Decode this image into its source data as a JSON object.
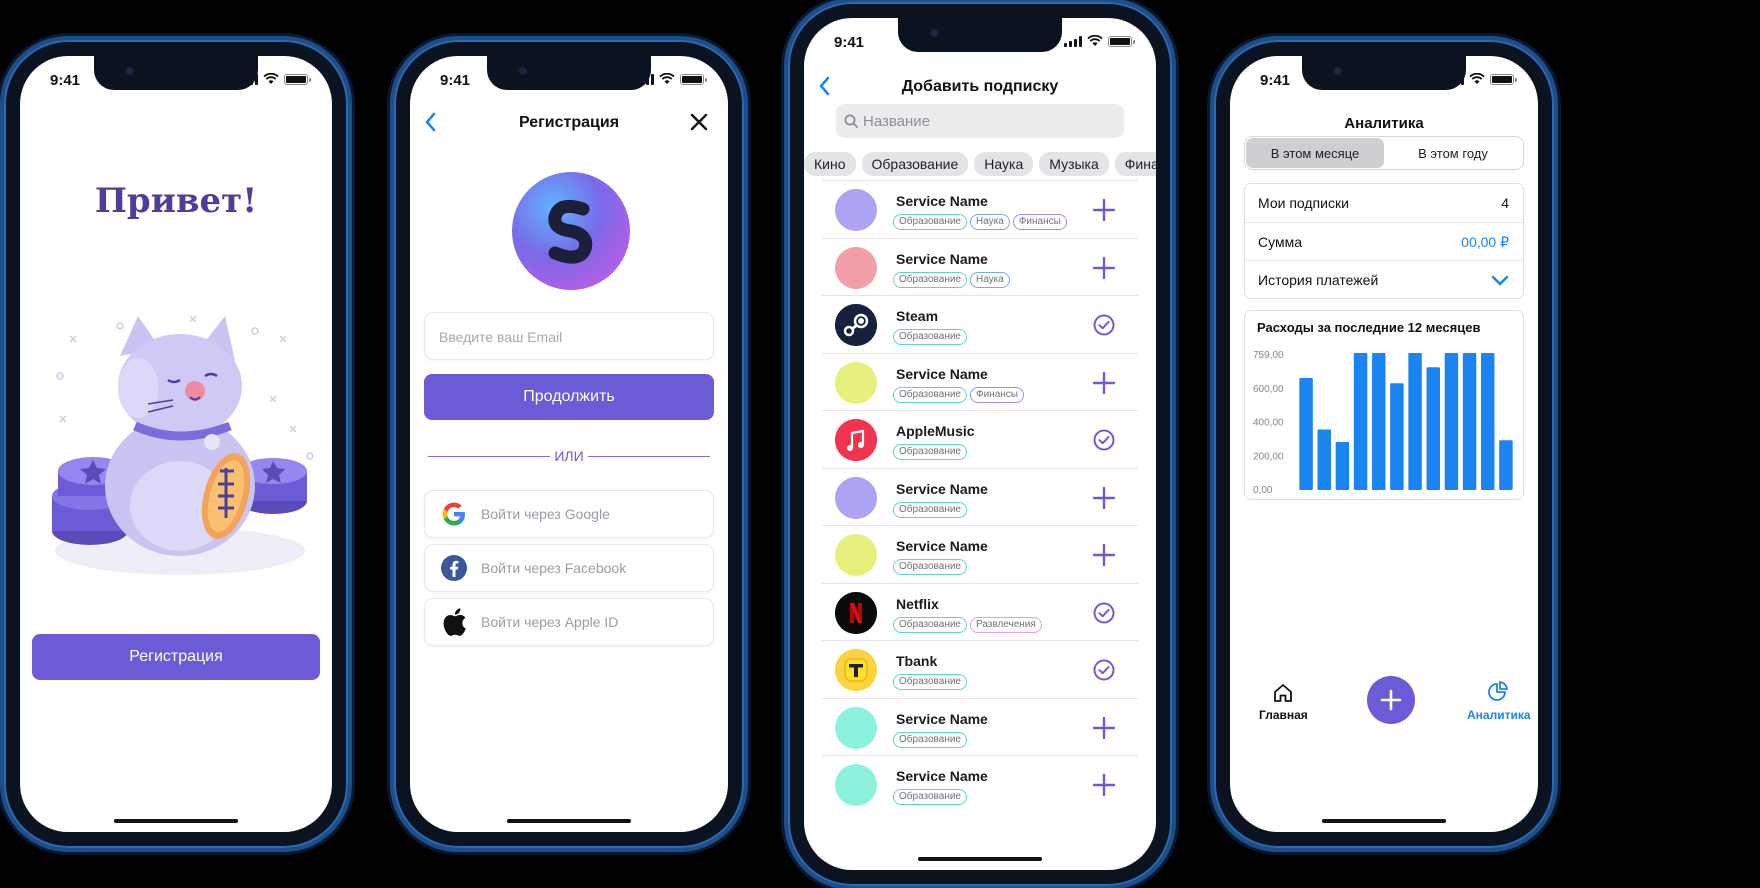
{
  "status_time": "9:41",
  "colors": {
    "accent": "#6b5bd6",
    "title_purple": "#4b3f9c",
    "blue": "#1a84f0",
    "tag_teal": "#5fd6c3"
  },
  "welcome": {
    "greeting": "Привет!",
    "register_button": "Регистрация"
  },
  "registration": {
    "title": "Регистрация",
    "email_placeholder": "Введите ваш Email",
    "continue_button": "Продолжить",
    "divider_text": "ИЛИ",
    "google_label": "Войти через Google",
    "facebook_label": "Войти через Facebook",
    "apple_label": "Войти через Apple ID"
  },
  "add_subscription": {
    "title": "Добавить подписку",
    "search_placeholder": "Название",
    "categories": [
      "Кино",
      "Образование",
      "Наука",
      "Музыка",
      "Финан"
    ],
    "items": [
      {
        "name": "Service Name",
        "color": "#aca4f2",
        "tags": [
          "Образование",
          "Наука",
          "Финансы"
        ],
        "added": false
      },
      {
        "name": "Service Name",
        "color": "#f2a0a8",
        "tags": [
          "Образование",
          "Наука"
        ],
        "added": false
      },
      {
        "name": "Steam",
        "color": "#1b2a4a",
        "tags": [
          "Образование"
        ],
        "added": true,
        "icon": "steam-logo"
      },
      {
        "name": "Service Name",
        "color": "#e6f07a",
        "tags": [
          "Образование",
          "Финансы"
        ],
        "added": false
      },
      {
        "name": "AppleMusic",
        "color": "#f0334f",
        "tags": [
          "Образование"
        ],
        "added": true,
        "icon": "apple-music-logo"
      },
      {
        "name": "Service Name",
        "color": "#aca4f2",
        "tags": [
          "Образование"
        ],
        "added": false
      },
      {
        "name": "Service Name",
        "color": "#e6f07a",
        "tags": [
          "Образование"
        ],
        "added": false
      },
      {
        "name": "Netflix",
        "color": "#0a0a0a",
        "tags": [
          "Образование",
          "Развлечения"
        ],
        "added": true,
        "icon": "netflix-logo"
      },
      {
        "name": "Tbank",
        "color": "#ffd23f",
        "tags": [
          "Образование"
        ],
        "added": true,
        "icon": "tbank-logo"
      },
      {
        "name": "Service Name",
        "color": "#8cf2de",
        "tags": [
          "Образование"
        ],
        "added": false
      },
      {
        "name": "Service Name",
        "color": "#8cf2de",
        "tags": [
          "Образование"
        ],
        "added": false
      }
    ]
  },
  "analytics": {
    "title": "Аналитика",
    "segment_month": "В этом месяце",
    "segment_year": "В этом году",
    "my_subs_label": "Мои подписки",
    "my_subs_value": "4",
    "sum_label": "Сумма",
    "sum_value": "00,00 ₽",
    "history_label": "История платежей",
    "chart_title": "Расходы за последние 12 месяцев",
    "tab_home": "Главная",
    "tab_analytics": "Аналитика"
  },
  "chart_data": {
    "type": "bar",
    "title": "Расходы за последние 12 месяцев",
    "y_ticks": [
      "759,00",
      "600,00",
      "400,00",
      "200,00",
      "0,00"
    ],
    "ylim": [
      0,
      759
    ],
    "values": [
      630,
      340,
      270,
      770,
      770,
      600,
      770,
      690,
      770,
      770,
      770,
      280
    ],
    "color": "#1a84f0",
    "grid": false
  }
}
